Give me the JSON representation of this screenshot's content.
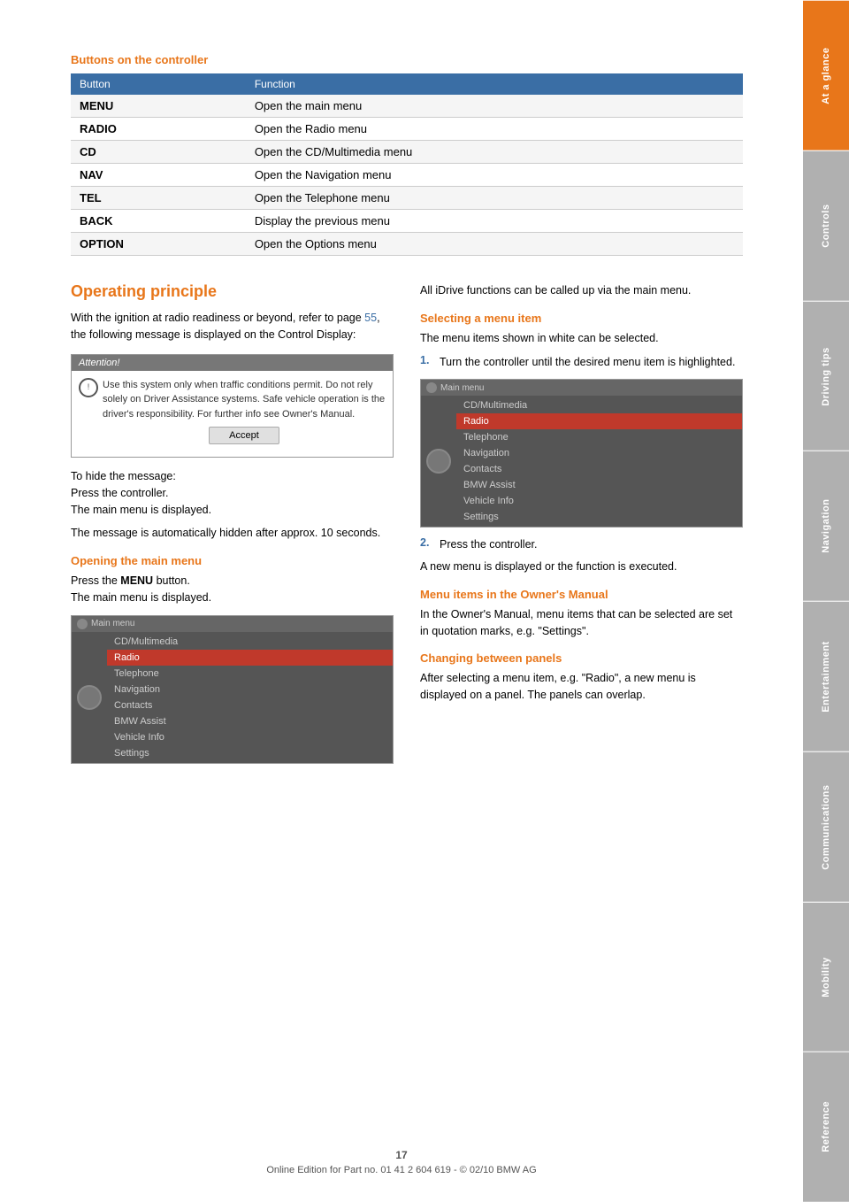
{
  "page": {
    "number": "17",
    "footer_text": "Online Edition for Part no. 01 41 2 604 619 - © 02/10 BMW AG"
  },
  "sidebar": {
    "tabs": [
      {
        "label": "At a glance",
        "active": true
      },
      {
        "label": "Controls",
        "active": false
      },
      {
        "label": "Driving tips",
        "active": false
      },
      {
        "label": "Navigation",
        "active": false
      },
      {
        "label": "Entertainment",
        "active": false
      },
      {
        "label": "Communications",
        "active": false
      },
      {
        "label": "Mobility",
        "active": false
      },
      {
        "label": "Reference",
        "active": false
      }
    ]
  },
  "buttons_section": {
    "title": "Buttons on the controller",
    "table": {
      "headers": [
        "Button",
        "Function"
      ],
      "rows": [
        {
          "button": "MENU",
          "function": "Open the main menu"
        },
        {
          "button": "RADIO",
          "function": "Open the Radio menu"
        },
        {
          "button": "CD",
          "function": "Open the CD/Multimedia menu"
        },
        {
          "button": "NAV",
          "function": "Open the Navigation menu"
        },
        {
          "button": "TEL",
          "function": "Open the Telephone menu"
        },
        {
          "button": "BACK",
          "function": "Display the previous menu"
        },
        {
          "button": "OPTION",
          "function": "Open the Options menu"
        }
      ]
    }
  },
  "operating_principle": {
    "title": "Operating principle",
    "intro_text": "With the ignition at radio readiness or beyond, refer to page 55, the following message is displayed on the Control Display:",
    "link_page": "55",
    "attention_box": {
      "header": "Attention!",
      "body": "Use this system only when traffic conditions permit. Do not rely solely on Driver Assistance systems. Safe vehicle operation is the driver's responsibility. For further info see Owner's Manual.",
      "accept_button": "Accept"
    },
    "hide_message_text": "To hide the message:\nPress the controller.\nThe main menu is displayed.",
    "auto_hide_text": "The message is automatically hidden after approx. 10 seconds.",
    "opening_main_menu": {
      "heading": "Opening the main menu",
      "text1": "Press the ",
      "bold": "MENU",
      "text2": " button.",
      "text3": "The main menu is displayed."
    },
    "main_menu_items_left": [
      "CD/Multimedia",
      "Radio",
      "Telephone",
      "Navigation",
      "Contacts",
      "BMW Assist",
      "Vehicle Info",
      "Settings"
    ],
    "right_col": {
      "intro_text": "All iDrive functions can be called up via the main menu.",
      "selecting_heading": "Selecting a menu item",
      "selecting_text": "The menu items shown in white can be selected.",
      "step1": "Turn the controller until the desired menu item is highlighted.",
      "main_menu_items_right": [
        "CD/Multimedia",
        "Radio",
        "Telephone",
        "Navigation",
        "Contacts",
        "BMW Assist",
        "Vehicle Info",
        "Settings"
      ],
      "step2": "Press the controller.",
      "step2_result": "A new menu is displayed or the function is executed.",
      "owners_manual_heading": "Menu items in the Owner's Manual",
      "owners_manual_text": "In the Owner's Manual, menu items that can be selected are set in quotation marks, e.g. \"Settings\".",
      "changing_panels_heading": "Changing between panels",
      "changing_panels_text": "After selecting a menu item, e.g. \"Radio\", a new menu is displayed on a panel. The panels can overlap."
    }
  }
}
